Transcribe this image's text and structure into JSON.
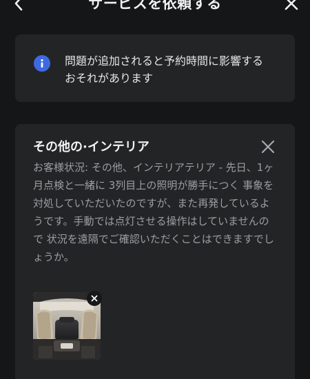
{
  "header": {
    "title": "サービスを依頼する",
    "back_icon": "chevron-left-icon",
    "close_icon": "close-icon"
  },
  "notice": {
    "icon": "info-icon",
    "text": "問題が追加されると予約時間に影響するおそれがあります",
    "accent": "#3e6ae1"
  },
  "issue_card": {
    "title": "その他の·インテリア",
    "description": "お客様状況: その他、インテリアテリア - 先日、1ヶ月点検と一緒に 3列目上の照明が勝手につく 事象を対処していただいたのですが、また再発しているようです。手動では点灯させる操作はしていませんので 状況を遠隔でご確認いただくことはできますでしょうか。",
    "close_icon": "close-icon",
    "attachment": {
      "type": "photo",
      "subject": "car-interior-seats",
      "remove_icon": "close-icon"
    }
  },
  "colors": {
    "background": "#151617",
    "card": "#232426",
    "text_primary": "#f1f1f2",
    "text_secondary": "#9c9ea2"
  }
}
